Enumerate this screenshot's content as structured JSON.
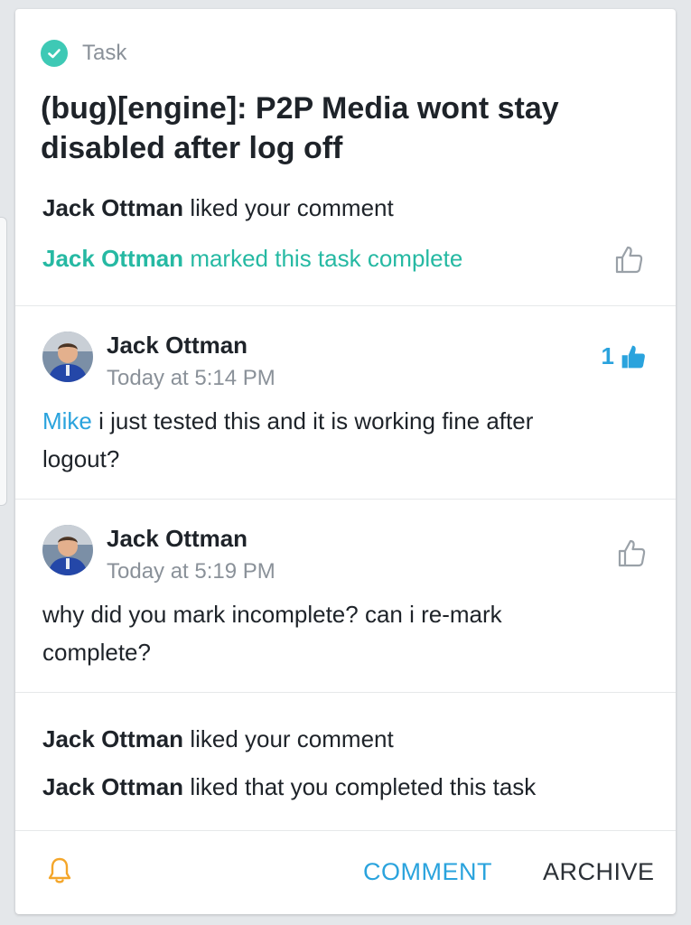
{
  "task": {
    "type_label": "Task",
    "title": "(bug)[engine]: P2P Media wont stay disabled after log off",
    "activity": [
      {
        "actor": "Jack Ottman",
        "action": "liked your comment"
      },
      {
        "actor": "Jack Ottman",
        "action": "marked this task complete"
      }
    ]
  },
  "comments": [
    {
      "author": "Jack Ottman",
      "time": "Today at 5:14 PM",
      "mention": "Mike",
      "text": "i just tested this and it is working fine after logout?",
      "likes": "1"
    },
    {
      "author": "Jack Ottman",
      "time": "Today at 5:19 PM",
      "mention": "",
      "text": "why did you mark incomplete? can i re-mark complete?",
      "likes": ""
    }
  ],
  "notices": [
    {
      "actor": "Jack Ottman",
      "action": "liked your comment"
    },
    {
      "actor": "Jack Ottman",
      "action": "liked that you completed this task"
    }
  ],
  "footer": {
    "comment_label": "COMMENT",
    "archive_label": "ARCHIVE"
  },
  "icons": {
    "task_check": "check-circle-icon",
    "like": "thumbs-up-icon",
    "bell": "bell-icon"
  },
  "colors": {
    "accent_teal": "#26b9a3",
    "link_blue": "#2aa3dd",
    "bell_orange": "#f4a62a"
  }
}
